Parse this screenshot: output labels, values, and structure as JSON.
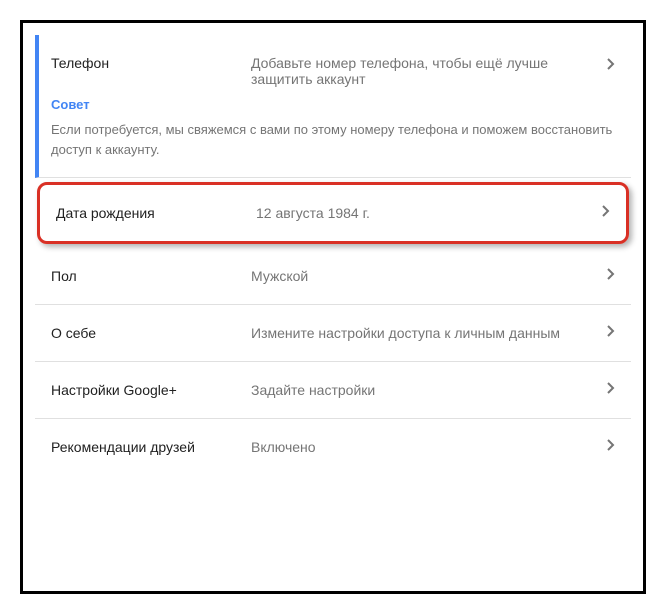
{
  "rows": {
    "phone": {
      "label": "Телефон",
      "value": "Добавьте номер телефона, чтобы ещё лучше защитить аккаунт"
    },
    "tip": {
      "label": "Совет",
      "text": "Если потребуется, мы свяжемся с вами по этому номеру телефона и поможем восстановить доступ к аккаунту."
    },
    "birthdate": {
      "label": "Дата рождения",
      "value": "12 августа 1984 г."
    },
    "gender": {
      "label": "Пол",
      "value": "Мужской"
    },
    "about": {
      "label": "О себе",
      "value": "Измените настройки доступа к личным данным"
    },
    "googleplus": {
      "label": "Настройки Google+",
      "value": "Задайте настройки"
    },
    "friends": {
      "label": "Рекомендации друзей",
      "value": "Включено"
    }
  }
}
